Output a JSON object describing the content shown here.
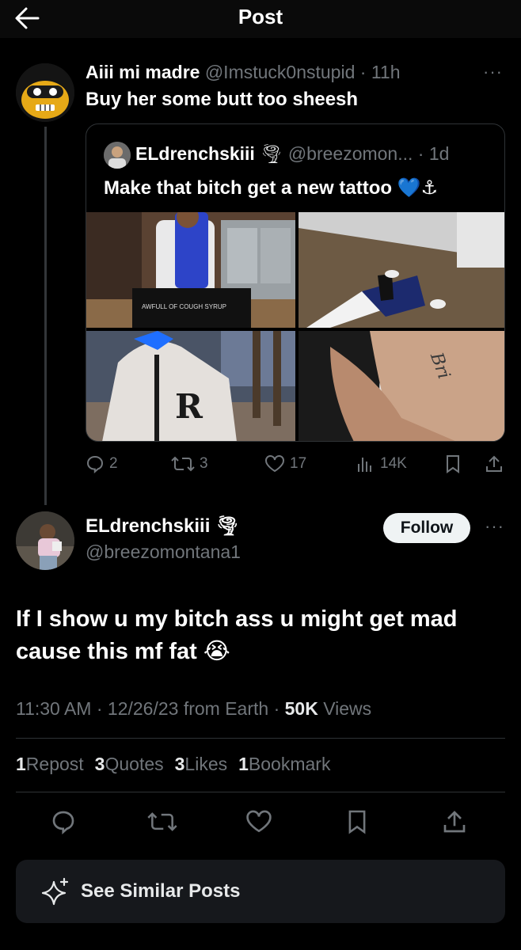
{
  "header": {
    "title": "Post"
  },
  "parent_post": {
    "display_name": "Aiii mi madre",
    "handle": "@Imstuck0nstupid",
    "age": "11h",
    "more": "···",
    "text": "Buy her some butt too sheesh",
    "quote": {
      "display_name": "ELdrenchskiii",
      "name_emoji": "🌪",
      "handle": "@breezomon...",
      "age": "1d",
      "text": "Make that bitch get a new tattoo 💙⚓",
      "media_text": {
        "shirt_print": "AWFULL OF COUGH SYRUP",
        "tattoo_text": "Bri"
      }
    },
    "actions": {
      "replies": "2",
      "reposts": "3",
      "likes": "17",
      "views": "14K"
    }
  },
  "main_post": {
    "display_name": "ELdrenchskiii",
    "name_emoji": "🌪",
    "handle": "@breezomontana1",
    "follow_label": "Follow",
    "more": "···",
    "text": "If I show u my bitch ass u might get mad cause this mf fat 😭",
    "meta": "11:30 AM · 12/26/23 from Earth · ",
    "views_count": "50K",
    "views_label": " Views",
    "stats": {
      "reposts_n": "1",
      "reposts_label": "Repost",
      "quotes_n": "3",
      "quotes_label": "Quotes",
      "likes_n": "3",
      "likes_label": "Likes",
      "bookmarks_n": "1",
      "bookmarks_label": "Bookmark"
    }
  },
  "similar_button": {
    "label": "See Similar Posts"
  },
  "colors": {
    "background": "#000000",
    "text": "#e7e9ea",
    "muted": "#71767b",
    "divider": "#2f3336",
    "heart_blue": "#1f6fff"
  }
}
